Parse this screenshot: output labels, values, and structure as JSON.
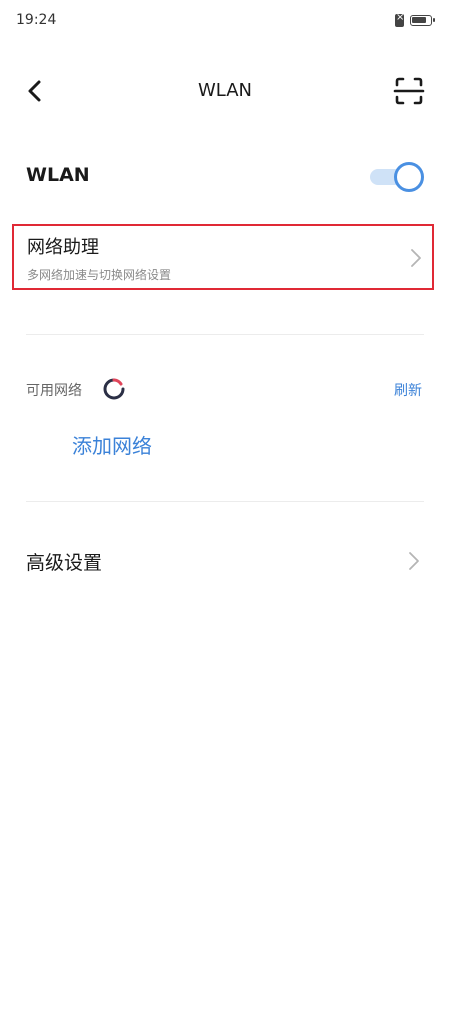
{
  "status_bar": {
    "time": "19:24",
    "icons": [
      "sim-off-icon",
      "battery-icon"
    ]
  },
  "nav": {
    "title": "WLAN",
    "back_icon": "back-arrow-icon",
    "scan_icon": "scan-icon"
  },
  "wlan": {
    "label": "WLAN",
    "enabled": true
  },
  "network_assistant": {
    "title": "网络助理",
    "subtitle": "多网络加速与切换网络设置"
  },
  "available_networks": {
    "label": "可用网络",
    "refresh_label": "刷新"
  },
  "add_network": {
    "label": "添加网络"
  },
  "advanced_settings": {
    "label": "高级设置"
  },
  "colors": {
    "accent": "#3b82d8",
    "highlight_border": "#e02935",
    "toggle_track": "#cfe2f7"
  }
}
